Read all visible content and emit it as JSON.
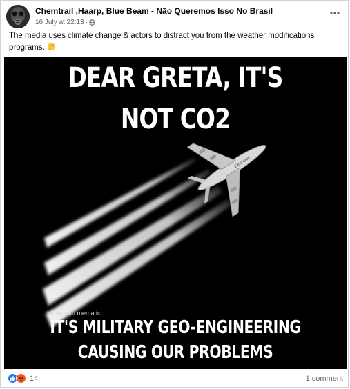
{
  "post": {
    "group_name": "Chemtrail ,Haarp, Blue Beam - Não Queremos Isso No Brasil",
    "timestamp": "16 July at 22:13",
    "separator": "·",
    "text": "The media uses climate change & actors to distract you from the weather modifications programs.",
    "emoji": "thinking-face"
  },
  "image": {
    "headline_line1": "DEAR GRETA, IT'S",
    "headline_line2": "NOT CO2",
    "bottom_line1": "IT'S MILITARY GEO-ENGINEERING",
    "bottom_line2": "CAUSING OUR PROBLEMS",
    "watermark": "Made with mematic",
    "plane_livery": "Emirates"
  },
  "footer": {
    "reaction_count": "14",
    "comments": "1 comment",
    "reaction_icons": [
      "like-icon",
      "angry-icon"
    ]
  },
  "colors": {
    "like_blue": "#1877f2",
    "angry_orange": "#f0592a",
    "meta_gray": "#65676b"
  }
}
